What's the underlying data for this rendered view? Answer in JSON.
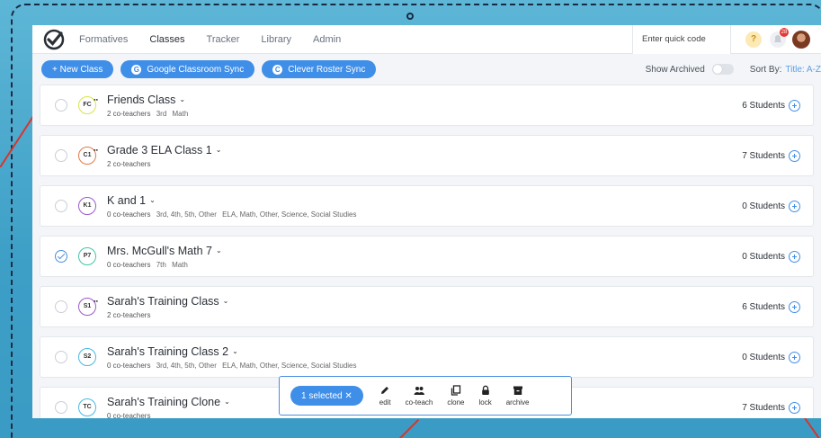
{
  "nav": {
    "links": [
      "Formatives",
      "Classes",
      "Tracker",
      "Library",
      "Admin"
    ],
    "active_index": 1,
    "quick_code_placeholder": "Enter quick code",
    "help_label": "?",
    "notification_count": "28"
  },
  "toolbar": {
    "new_class": "+ New Class",
    "google_sync": "Google Classroom Sync",
    "clever_sync": "Clever Roster Sync",
    "show_archived": "Show Archived",
    "sort_label": "Sort By:",
    "sort_value": "Title: A-Z"
  },
  "classes": [
    {
      "initials": "FC",
      "color": "#d8e34a",
      "name": "Friends Class",
      "coteach": true,
      "coteachers": "2 co-teachers",
      "grades": "3rd",
      "subjects": "Math",
      "students": "6 Students",
      "selected": false
    },
    {
      "initials": "C1",
      "color": "#e07a4a",
      "name": "Grade 3 ELA Class 1",
      "coteach": true,
      "coteachers": "2 co-teachers",
      "grades": "",
      "subjects": "",
      "students": "7 Students",
      "selected": false
    },
    {
      "initials": "K1",
      "color": "#9b59d0",
      "name": "K and 1",
      "coteach": false,
      "coteachers": "0 co-teachers",
      "grades": "3rd, 4th, 5th, Other",
      "subjects": "ELA, Math, Other, Science, Social Studies",
      "students": "0 Students",
      "selected": false
    },
    {
      "initials": "P7",
      "color": "#3ec7a8",
      "name": "Mrs. McGull's Math 7",
      "coteach": false,
      "coteachers": "0 co-teachers",
      "grades": "7th",
      "subjects": "Math",
      "students": "0 Students",
      "selected": true
    },
    {
      "initials": "S1",
      "color": "#9b59d0",
      "name": "Sarah's Training Class",
      "coteach": true,
      "coteachers": "2 co-teachers",
      "grades": "",
      "subjects": "",
      "students": "6 Students",
      "selected": false
    },
    {
      "initials": "S2",
      "color": "#4ab8e0",
      "name": "Sarah's Training Class 2",
      "coteach": false,
      "coteachers": "0 co-teachers",
      "grades": "3rd, 4th, 5th, Other",
      "subjects": "ELA, Math, Other, Science, Social Studies",
      "students": "0 Students",
      "selected": false
    },
    {
      "initials": "TC",
      "color": "#4ab8e0",
      "name": "Sarah's Training Clone",
      "coteach": false,
      "coteachers": "0 co-teachers",
      "grades": "",
      "subjects": "",
      "students": "7 Students",
      "selected": false
    }
  ],
  "selection_bar": {
    "selected_label": "1 selected ✕",
    "actions": [
      "edit",
      "co-teach",
      "clone",
      "lock",
      "archive"
    ]
  }
}
